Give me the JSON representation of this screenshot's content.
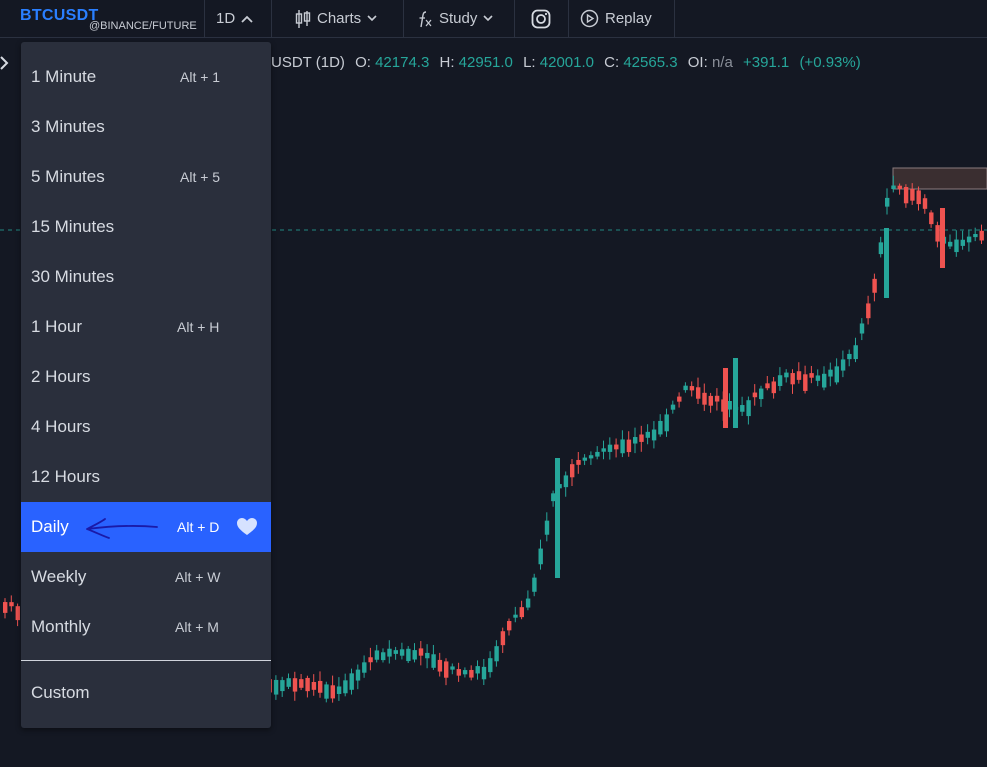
{
  "header": {
    "symbol": "BTCUSDT",
    "exchange": "@BINANCE/FUTURE",
    "interval": "1D",
    "charts_label": "Charts",
    "study_label": "Study",
    "replay_label": "Replay"
  },
  "legend": {
    "title": "USDT (1D)",
    "open_label": "O:",
    "open": "42174.3",
    "high_label": "H:",
    "high": "42951.0",
    "low_label": "L:",
    "low": "42001.0",
    "close_label": "C:",
    "close": "42565.3",
    "oi_label": "OI:",
    "oi": "n/a",
    "change": "+391.1",
    "change_pct": "(+0.93%)"
  },
  "colors": {
    "up": "#26a69a",
    "down": "#ef5350",
    "accent": "#2962ff",
    "symbol": "#2a7fff",
    "menu_bg": "#2a2f3c",
    "chart_bg": "#141823"
  },
  "menu": {
    "items": [
      {
        "label": "1 Minute",
        "shortcut": "Alt + 1"
      },
      {
        "label": "3 Minutes",
        "shortcut": ""
      },
      {
        "label": "5 Minutes",
        "shortcut": "Alt + 5"
      },
      {
        "label": "15 Minutes",
        "shortcut": ""
      },
      {
        "label": "30 Minutes",
        "shortcut": ""
      },
      {
        "label": "1 Hour",
        "shortcut": "Alt + H"
      },
      {
        "label": "2 Hours",
        "shortcut": ""
      },
      {
        "label": "4 Hours",
        "shortcut": ""
      },
      {
        "label": "12 Hours",
        "shortcut": ""
      },
      {
        "label": "Daily",
        "shortcut": "Alt + D",
        "selected": true
      },
      {
        "label": "Weekly",
        "shortcut": "Alt + W"
      },
      {
        "label": "Monthly",
        "shortcut": "Alt + M"
      }
    ],
    "custom_label": "Custom",
    "icons": {
      "favorite": "heart-icon",
      "annotation": "hand-drawn-arrow"
    }
  }
}
